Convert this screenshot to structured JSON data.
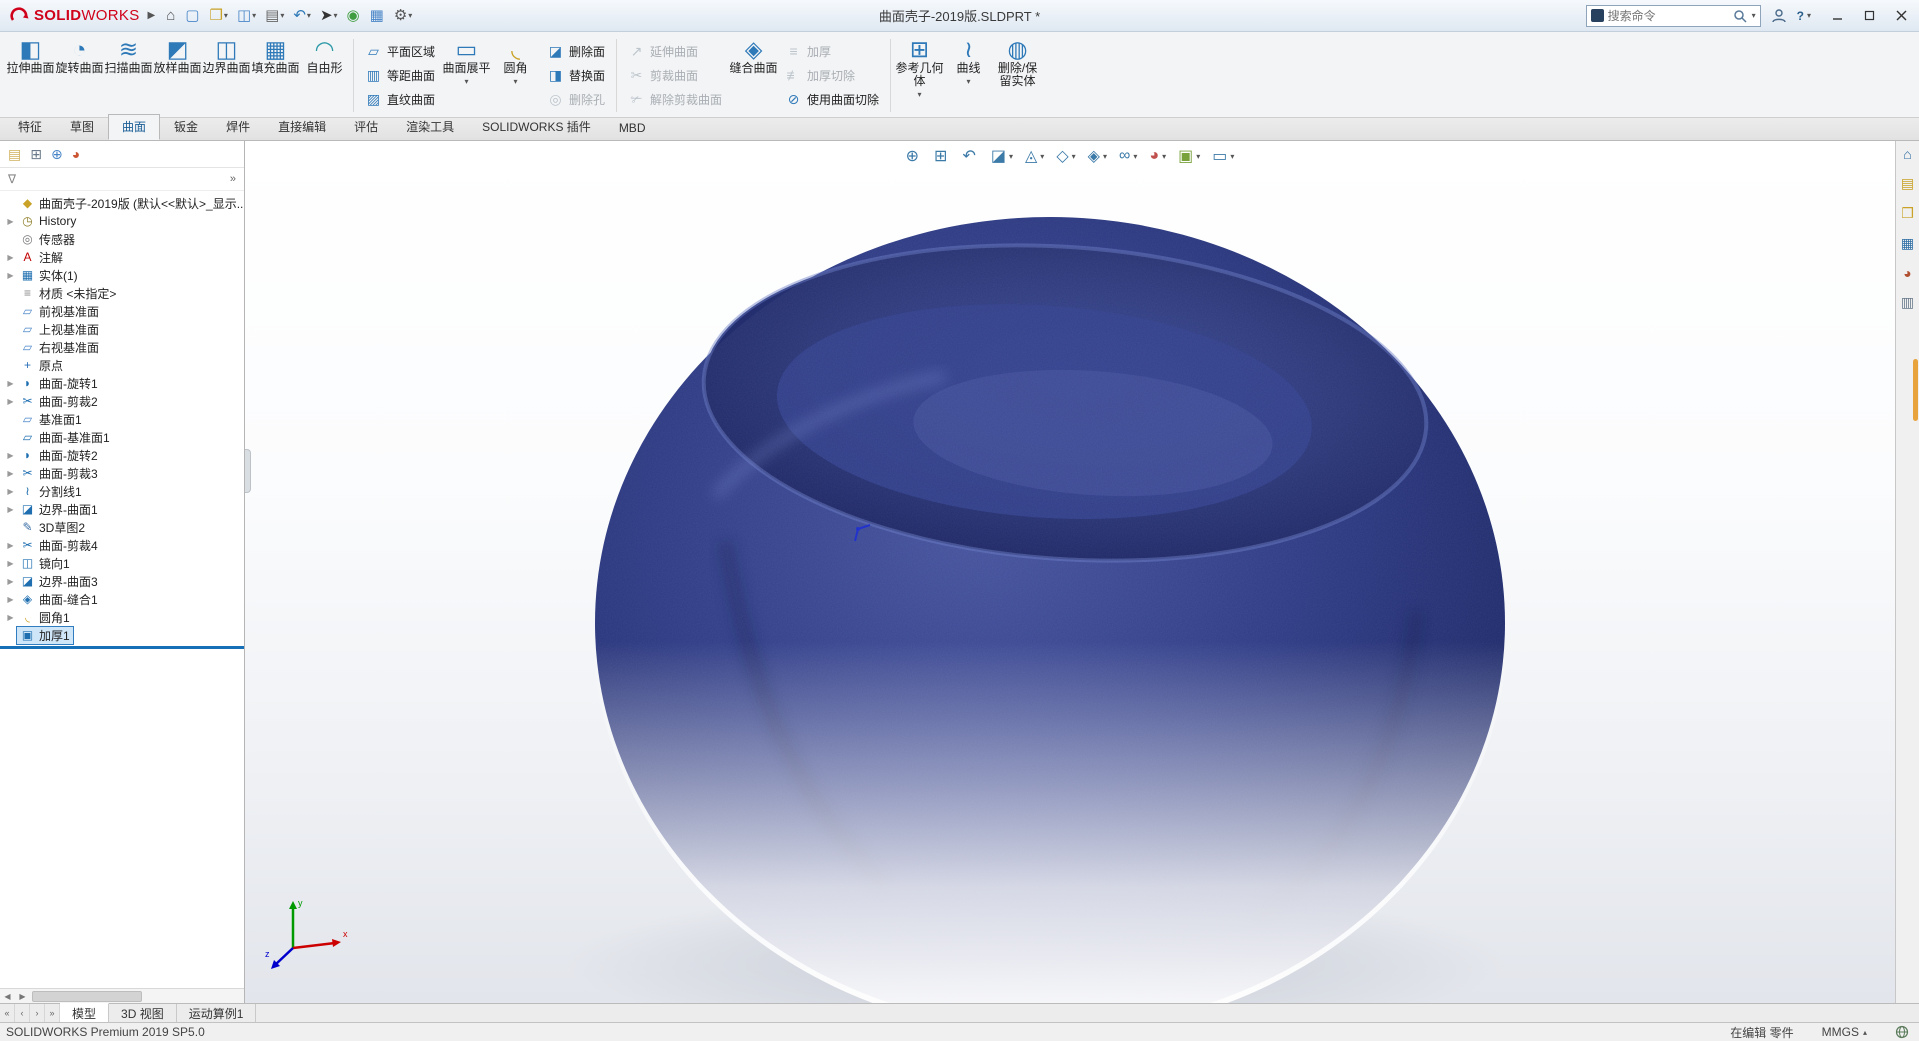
{
  "window": {
    "brand_bold": "SOLID",
    "brand_light": "WORKS",
    "title": "曲面壳子-2019版.SLDPRT *",
    "search_placeholder": "搜索命令"
  },
  "glyphs": {
    "menu_expand": "▶",
    "dropdown": "▾",
    "help": "?",
    "panel_chevron": "»",
    "filter": "∇"
  },
  "qat": [
    {
      "name": "home-icon",
      "glyph": "⌂",
      "color": "#555555",
      "arrow": ""
    },
    {
      "name": "new-document-icon",
      "glyph": "▢",
      "color": "#4a86c8",
      "arrow": ""
    },
    {
      "name": "open-icon",
      "glyph": "❒",
      "color": "#c9a227",
      "arrow": "▾"
    },
    {
      "name": "save-icon",
      "glyph": "◫",
      "color": "#4a86c8",
      "arrow": "▾"
    },
    {
      "name": "print-icon",
      "glyph": "▤",
      "color": "#666666",
      "arrow": "▾"
    },
    {
      "name": "undo-icon",
      "glyph": "↶",
      "color": "#2e79b8",
      "arrow": "▾"
    },
    {
      "name": "select-cursor-icon",
      "glyph": "➤",
      "color": "#333333",
      "arrow": "▾"
    },
    {
      "name": "rebuild-icon",
      "glyph": "◉",
      "color": "#3f9d3f",
      "arrow": ""
    },
    {
      "name": "file-properties-icon",
      "glyph": "▦",
      "color": "#4a86c8",
      "arrow": ""
    },
    {
      "name": "options-gear-icon",
      "glyph": "⚙",
      "color": "#555555",
      "arrow": "▾"
    }
  ],
  "ribbon": {
    "main": [
      {
        "label": "拉伸曲面",
        "glyph": "◧",
        "color": "#2e79b8",
        "state": "enabled",
        "arrow": ""
      },
      {
        "label": "旋转曲面",
        "glyph": "◔",
        "color": "#2e79b8",
        "state": "enabled",
        "arrow": ""
      },
      {
        "label": "扫描曲面",
        "glyph": "≋",
        "color": "#2e79b8",
        "state": "enabled",
        "arrow": ""
      },
      {
        "label": "放样曲面",
        "glyph": "◩",
        "color": "#2e79b8",
        "state": "enabled",
        "arrow": ""
      },
      {
        "label": "边界曲面",
        "glyph": "◫",
        "color": "#2e79b8",
        "state": "enabled",
        "arrow": ""
      },
      {
        "label": "填充曲面",
        "glyph": "▦",
        "color": "#2e79b8",
        "state": "enabled",
        "arrow": ""
      },
      {
        "label": "自由形",
        "glyph": "◠",
        "color": "#2e9aa8",
        "state": "enabled",
        "arrow": ""
      }
    ],
    "planar": [
      {
        "label": "平面区域",
        "glyph": "▱",
        "color": "#2e79b8",
        "state": "enabled",
        "arrow": ""
      },
      {
        "label": "等距曲面",
        "glyph": "▥",
        "color": "#2e79b8",
        "state": "enabled",
        "arrow": ""
      },
      {
        "label": "直纹曲面",
        "glyph": "▨",
        "color": "#2e79b8",
        "state": "enabled",
        "arrow": ""
      }
    ],
    "larges2": [
      {
        "label": "曲面展平",
        "glyph": "▭",
        "color": "#2e79b8",
        "state": "enabled",
        "arrow": "▾"
      },
      {
        "label": "圆角",
        "glyph": "◟",
        "color": "#c9a227",
        "state": "enabled",
        "arrow": "▾"
      }
    ],
    "faces": [
      {
        "label": "删除面",
        "glyph": "◪",
        "color": "#2e79b8",
        "state": "enabled",
        "arrow": ""
      },
      {
        "label": "替换面",
        "glyph": "◨",
        "color": "#2e79b8",
        "state": "enabled",
        "arrow": ""
      },
      {
        "label": "删除孔",
        "glyph": "◎",
        "color": "#2e79b8",
        "state": "disabled",
        "arrow": ""
      }
    ],
    "extend": [
      {
        "label": "延伸曲面",
        "glyph": "↗",
        "color": "#2e79b8",
        "state": "disabled",
        "arrow": ""
      },
      {
        "label": "剪裁曲面",
        "glyph": "✂",
        "color": "#2e79b8",
        "state": "disabled",
        "arrow": ""
      },
      {
        "label": "解除剪裁曲面",
        "glyph": "✃",
        "color": "#2e79b8",
        "state": "disabled",
        "arrow": ""
      }
    ],
    "knit": [
      {
        "label": "缝合曲面",
        "glyph": "◈",
        "color": "#2e79b8",
        "state": "enabled",
        "arrow": ""
      }
    ],
    "thicken": [
      {
        "label": "加厚",
        "glyph": "≡",
        "color": "#2e79b8",
        "state": "disabled",
        "arrow": ""
      },
      {
        "label": "加厚切除",
        "glyph": "≢",
        "color": "#2e79b8",
        "state": "disabled",
        "arrow": ""
      },
      {
        "label": "使用曲面切除",
        "glyph": "⊘",
        "color": "#2e79b8",
        "state": "enabled",
        "arrow": ""
      }
    ],
    "reference": [
      {
        "label": "参考几何体",
        "glyph": "⊞",
        "color": "#2e79b8",
        "state": "enabled",
        "arrow": "▾"
      },
      {
        "label": "曲线",
        "glyph": "≀",
        "color": "#2e79b8",
        "state": "enabled",
        "arrow": "▾"
      },
      {
        "label": "删除/保留实体",
        "glyph": "◍",
        "color": "#2e79b8",
        "state": "enabled",
        "arrow": ""
      }
    ]
  },
  "tabs": [
    {
      "label": "特征",
      "cls": "plain"
    },
    {
      "label": "草图",
      "cls": "plain"
    },
    {
      "label": "曲面",
      "cls": "active"
    },
    {
      "label": "钣金",
      "cls": "plain"
    },
    {
      "label": "焊件",
      "cls": "plain"
    },
    {
      "label": "直接编辑",
      "cls": "plain"
    },
    {
      "label": "评估",
      "cls": "plain"
    },
    {
      "label": "渲染工具",
      "cls": "plain"
    },
    {
      "label": "SOLIDWORKS 插件",
      "cls": "plain"
    },
    {
      "label": "MBD",
      "cls": "plain"
    }
  ],
  "panel": {
    "managers": [
      {
        "name": "featuremanager-tab-icon",
        "glyph": "▤",
        "color": "#d0b060"
      },
      {
        "name": "propertymanager-tab-icon",
        "glyph": "⊞",
        "color": "#6a7a8a"
      },
      {
        "name": "configurationmanager-tab-icon",
        "glyph": "⊕",
        "color": "#4a86c8"
      },
      {
        "name": "displaymanager-tab-icon",
        "glyph": "◕",
        "color": "#cc5533"
      }
    ]
  },
  "tree": {
    "items": [
      {
        "label": "曲面壳子-2019版 (默认<<默认>_显示...",
        "arrow": "",
        "glyph": "◆",
        "color": "#c9a227",
        "cls": "root"
      },
      {
        "label": "History",
        "arrow": "▶",
        "glyph": "◷",
        "color": "#8a7a20",
        "cls": "plain"
      },
      {
        "label": "传感器",
        "arrow": "",
        "glyph": "◎",
        "color": "#777777",
        "cls": "plain"
      },
      {
        "label": "注解",
        "arrow": "▶",
        "glyph": "A",
        "color": "#c00000",
        "cls": "plain"
      },
      {
        "label": "实体(1)",
        "arrow": "▶",
        "glyph": "▦",
        "color": "#1f6fb0",
        "cls": "plain"
      },
      {
        "label": "材质 <未指定>",
        "arrow": "",
        "glyph": "≡",
        "color": "#888888",
        "cls": "plain"
      },
      {
        "label": "前视基准面",
        "arrow": "",
        "glyph": "▱",
        "color": "#4a86c8",
        "cls": "plain"
      },
      {
        "label": "上视基准面",
        "arrow": "",
        "glyph": "▱",
        "color": "#4a86c8",
        "cls": "plain"
      },
      {
        "label": "右视基准面",
        "arrow": "",
        "glyph": "▱",
        "color": "#4a86c8",
        "cls": "plain"
      },
      {
        "label": "原点",
        "arrow": "",
        "glyph": "+",
        "color": "#2a6fb8",
        "cls": "plain"
      },
      {
        "label": "曲面-旋转1",
        "arrow": "▶",
        "glyph": "◗",
        "color": "#1f6fb0",
        "cls": "plain"
      },
      {
        "label": "曲面-剪裁2",
        "arrow": "▶",
        "glyph": "✂",
        "color": "#1f6fb0",
        "cls": "plain"
      },
      {
        "label": "基准面1",
        "arrow": "",
        "glyph": "▱",
        "color": "#4a86c8",
        "cls": "plain"
      },
      {
        "label": "曲面-基准面1",
        "arrow": "",
        "glyph": "▱",
        "color": "#1f6fb0",
        "cls": "plain"
      },
      {
        "label": "曲面-旋转2",
        "arrow": "▶",
        "glyph": "◗",
        "color": "#1f6fb0",
        "cls": "plain"
      },
      {
        "label": "曲面-剪裁3",
        "arrow": "▶",
        "glyph": "✂",
        "color": "#1f6fb0",
        "cls": "plain"
      },
      {
        "label": "分割线1",
        "arrow": "▶",
        "glyph": "≀",
        "color": "#1f6fb0",
        "cls": "plain"
      },
      {
        "label": "边界-曲面1",
        "arrow": "▶",
        "glyph": "◪",
        "color": "#1f6fb0",
        "cls": "plain"
      },
      {
        "label": "3D草图2",
        "arrow": "",
        "glyph": "✎",
        "color": "#3a6ea5",
        "cls": "plain"
      },
      {
        "label": "曲面-剪裁4",
        "arrow": "▶",
        "glyph": "✂",
        "color": "#1f6fb0",
        "cls": "plain"
      },
      {
        "label": "镜向1",
        "arrow": "▶",
        "glyph": "◫",
        "color": "#1f6fb0",
        "cls": "plain"
      },
      {
        "label": "边界-曲面3",
        "arrow": "▶",
        "glyph": "◪",
        "color": "#1f6fb0",
        "cls": "plain"
      },
      {
        "label": "曲面-缝合1",
        "arrow": "▶",
        "glyph": "◈",
        "color": "#1f6fb0",
        "cls": "plain"
      },
      {
        "label": "圆角1",
        "arrow": "▶",
        "glyph": "◟",
        "color": "#c9a227",
        "cls": "plain"
      },
      {
        "label": "加厚1",
        "arrow": "",
        "glyph": "▣",
        "color": "#1f6fb0",
        "cls": "selected"
      }
    ]
  },
  "hud": [
    {
      "name": "zoom-fit-icon",
      "glyph": "⊕",
      "color": "#3c7aa8",
      "arrow": ""
    },
    {
      "name": "zoom-area-icon",
      "glyph": "⊞",
      "color": "#3c7aa8",
      "arrow": ""
    },
    {
      "name": "previous-view-icon",
      "glyph": "↶",
      "color": "#3c7aa8",
      "arrow": ""
    },
    {
      "name": "section-view-icon",
      "glyph": "◪",
      "color": "#3c7aa8",
      "arrow": "▾"
    },
    {
      "name": "annotation-views-icon",
      "glyph": "◬",
      "color": "#3c7aa8",
      "arrow": "▾"
    },
    {
      "name": "view-orientation-icon",
      "glyph": "◇",
      "color": "#3c7aa8",
      "arrow": "▾"
    },
    {
      "name": "display-style-icon",
      "glyph": "◈",
      "color": "#3c7aa8",
      "arrow": "▾"
    },
    {
      "name": "hide-show-items-icon",
      "glyph": "∞",
      "color": "#3c7aa8",
      "arrow": "▾"
    },
    {
      "name": "edit-appearance-icon",
      "glyph": "◕",
      "color": "#c0504d",
      "arrow": "▾"
    },
    {
      "name": "apply-scene-icon",
      "glyph": "▣",
      "color": "#7aa23c",
      "arrow": "▾"
    },
    {
      "name": "view-settings-icon",
      "glyph": "▭",
      "color": "#3c7aa8",
      "arrow": "▾"
    }
  ],
  "taskpane": [
    {
      "name": "task-home-icon",
      "glyph": "⌂",
      "color": "#2e6da4"
    },
    {
      "name": "design-library-icon",
      "glyph": "▤",
      "color": "#c9a227"
    },
    {
      "name": "file-explorer-icon",
      "glyph": "❒",
      "color": "#c9a227"
    },
    {
      "name": "view-palette-icon",
      "glyph": "▦",
      "color": "#2e6da4"
    },
    {
      "name": "appearances-scenes-icon",
      "glyph": "◕",
      "color": "#b05030"
    },
    {
      "name": "custom-properties-icon",
      "glyph": "▥",
      "color": "#667788"
    }
  ],
  "model_tabs": {
    "nav": [
      {
        "name": "first-tab-icon",
        "glyph": "«"
      },
      {
        "name": "prev-tab-icon",
        "glyph": "‹"
      },
      {
        "name": "next-tab-icon",
        "glyph": "›"
      },
      {
        "name": "last-tab-icon",
        "glyph": "»"
      }
    ],
    "tabs": [
      {
        "label": "模型",
        "cls": "active"
      },
      {
        "label": "3D 视图",
        "cls": "plain"
      },
      {
        "label": "运动算例1",
        "cls": "plain"
      }
    ]
  },
  "statusbar": {
    "left": "SOLIDWORKS Premium 2019 SP5.0",
    "editing": "在编辑 零件",
    "units": "MMGS",
    "units_arrow": "▴"
  }
}
